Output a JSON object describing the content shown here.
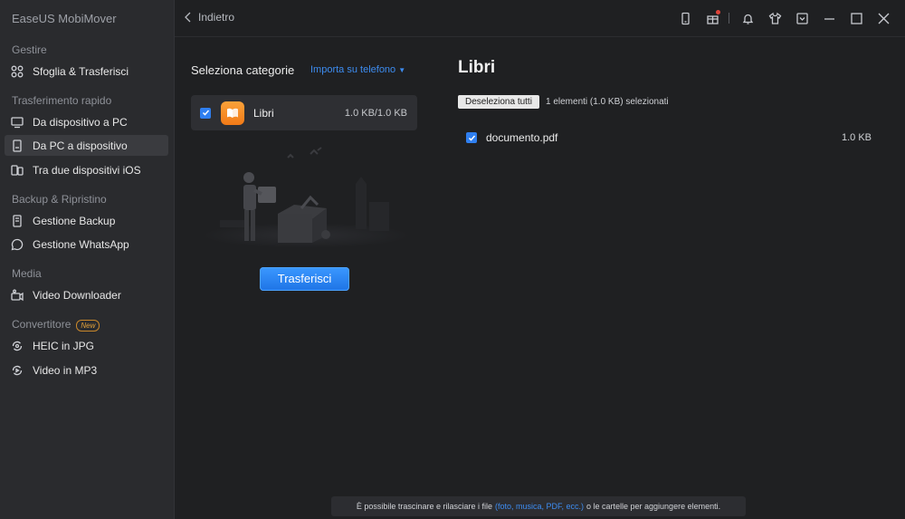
{
  "app": {
    "title": "EaseUS MobiMover"
  },
  "sidebar": {
    "sections": [
      {
        "label": "Gestire",
        "items": [
          {
            "label": "Sfoglia & Trasferisci",
            "icon": "apps-icon"
          }
        ]
      },
      {
        "label": "Trasferimento rapido",
        "items": [
          {
            "label": "Da dispositivo a PC",
            "icon": "phone-to-pc-icon"
          },
          {
            "label": "Da PC a dispositivo",
            "icon": "pc-to-phone-icon",
            "active": true
          },
          {
            "label": "Tra due dispositivi iOS",
            "icon": "phones-icon"
          }
        ]
      },
      {
        "label": "Backup & Ripristino",
        "items": [
          {
            "label": "Gestione Backup",
            "icon": "backup-icon"
          },
          {
            "label": "Gestione WhatsApp",
            "icon": "whatsapp-icon"
          }
        ]
      },
      {
        "label": "Media",
        "items": [
          {
            "label": "Video Downloader",
            "icon": "download-icon"
          }
        ]
      },
      {
        "label": "Convertitore",
        "badge": "New",
        "items": [
          {
            "label": "HEIC in JPG",
            "icon": "convert-image-icon"
          },
          {
            "label": "Video in MP3",
            "icon": "convert-video-icon"
          }
        ]
      }
    ]
  },
  "topbar": {
    "back_label": "Indietro",
    "icons": [
      "device-icon",
      "gift-icon",
      "bell-icon",
      "shirt-icon",
      "dropdown-box-icon",
      "minimize-icon",
      "maximize-icon",
      "close-icon"
    ]
  },
  "categories": {
    "title": "Seleziona categorie",
    "import_link": "Importa su telefono",
    "items": [
      {
        "name": "Libri",
        "size": "1.0 KB/1.0 KB",
        "checked": true
      }
    ]
  },
  "transfer_button": "Trasferisci",
  "files": {
    "title": "Libri",
    "deselect_label": "Deseleziona tutti",
    "selection_info": "1 elementi (1.0 KB) selezionati",
    "items": [
      {
        "name": "documento.pdf",
        "size": "1.0 KB",
        "checked": true
      }
    ]
  },
  "hint": {
    "before": "È possibile trascinare e rilasciare i file",
    "highlight": "(foto, musica, PDF, ecc.)",
    "after": "o le cartelle per aggiungere elementi."
  },
  "colors": {
    "accent": "#2f7ff0",
    "sidebar_bg": "#2a2b2e",
    "main_bg": "#1f2022",
    "badge": "#e0a03a",
    "books_icon": "#f5891f"
  }
}
